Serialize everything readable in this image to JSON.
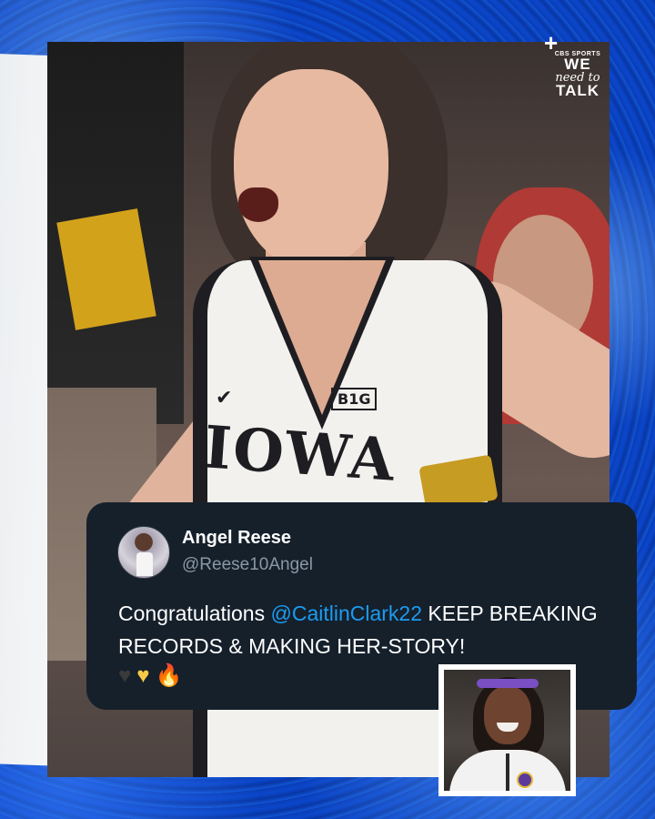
{
  "brand": {
    "network": "CBS SPORTS",
    "line1": "WE",
    "line2": "need to",
    "line3": "TALK"
  },
  "photo": {
    "jersey_text": "IOWA",
    "conference_badge": "B1G"
  },
  "tweet": {
    "name": "Angel Reese",
    "handle": "@Reese10Angel",
    "text_before": "Congratulations ",
    "mention": "@CaitlinClark22",
    "text_after": " KEEP BREAKING RECORDS & MAKING HER-STORY!",
    "emoji_1": "♥",
    "emoji_2": "♥",
    "emoji_3": "🔥"
  },
  "colors": {
    "background": "#0b3fb8",
    "card": "#15202b",
    "mention": "#1d9bf0",
    "handle": "#8b98a5"
  },
  "icons": [
    "plus-icon",
    "black-heart-icon",
    "yellow-heart-icon",
    "fire-icon",
    "swoosh-icon"
  ]
}
